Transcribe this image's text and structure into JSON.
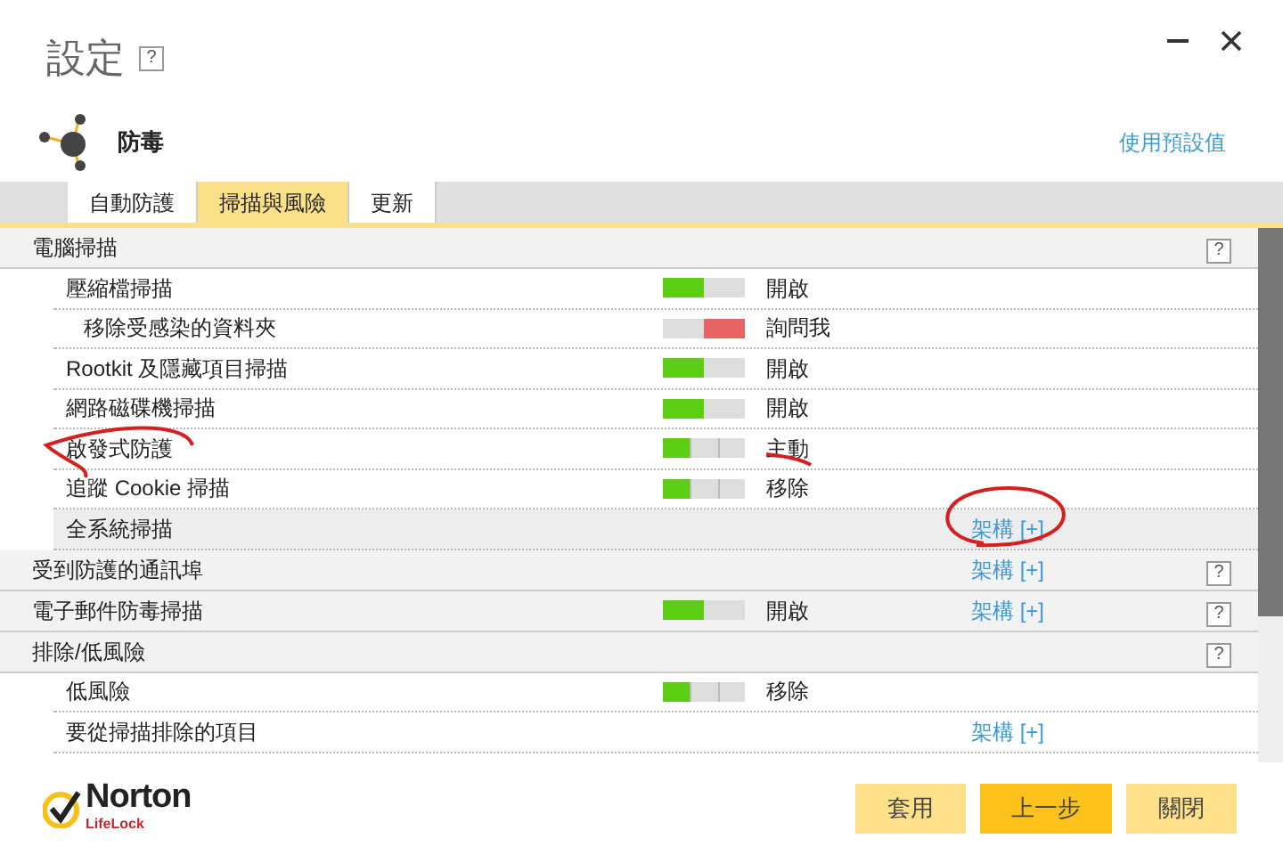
{
  "window": {
    "title": "設定",
    "help": "?"
  },
  "header": {
    "title": "防毒",
    "link": "使用預設值"
  },
  "tabs": [
    {
      "label": "自動防護",
      "selected": false
    },
    {
      "label": "掃描與風險",
      "selected": true
    },
    {
      "label": "更新",
      "selected": false
    }
  ],
  "sections": [
    {
      "title": "電腦掃描",
      "help": "?",
      "items": [
        {
          "label": "壓縮檔掃描",
          "selected": false,
          "slider": {
            "kind": "toggle",
            "level": 0.5,
            "color": "#5ccc14"
          },
          "value": "開啟",
          "children": [
            {
              "label": "移除受感染的資料夾",
              "selected": false,
              "slider": {
                "kind": "ask",
                "level": 0.5,
                "color": "#e86464"
              },
              "value": "詢問我"
            }
          ]
        },
        {
          "label": "Rootkit 及隱藏項目掃描",
          "selected": false,
          "slider": {
            "kind": "toggle",
            "level": 0.5,
            "color": "#5ccc14"
          },
          "value": "開啟"
        },
        {
          "label": "網路磁碟機掃描",
          "selected": false,
          "slider": {
            "kind": "toggle",
            "level": 0.5,
            "color": "#5ccc14"
          },
          "value": "開啟"
        },
        {
          "label": "啟發式防護",
          "selected": false,
          "slider": {
            "kind": "three-way",
            "level": 0.33,
            "color": "#5ccc14"
          },
          "value": "主動"
        },
        {
          "label": "追蹤 Cookie 掃描",
          "selected": false,
          "slider": {
            "kind": "three-way",
            "level": 0.33,
            "color": "#5ccc14"
          },
          "value": "移除"
        },
        {
          "label": "全系統掃描",
          "selected": true,
          "link": "架構 [+]"
        }
      ]
    },
    {
      "title": "受到防護的通訊埠",
      "link": "架構 [+]",
      "help": "?"
    },
    {
      "title": "電子郵件防毒掃描",
      "slider": {
        "kind": "toggle",
        "level": 0.5,
        "color": "#5ccc14"
      },
      "value": "開啟",
      "link": "架構 [+]",
      "help": "?"
    },
    {
      "title": "排除/低風險",
      "help": "?",
      "items": [
        {
          "label": "低風險",
          "selected": false,
          "slider": {
            "kind": "three-way",
            "level": 0.33,
            "color": "#5ccc14"
          },
          "value": "移除"
        },
        {
          "label": "要從掃描排除的項目",
          "selected": false,
          "link": "架構 [+]"
        }
      ]
    }
  ],
  "logo": {
    "name": "Norton",
    "sub": "LifeLock"
  },
  "buttons": [
    {
      "label": "套用",
      "primary": false
    },
    {
      "label": "上一步",
      "primary": true
    },
    {
      "label": "關閉",
      "primary": false
    }
  ]
}
